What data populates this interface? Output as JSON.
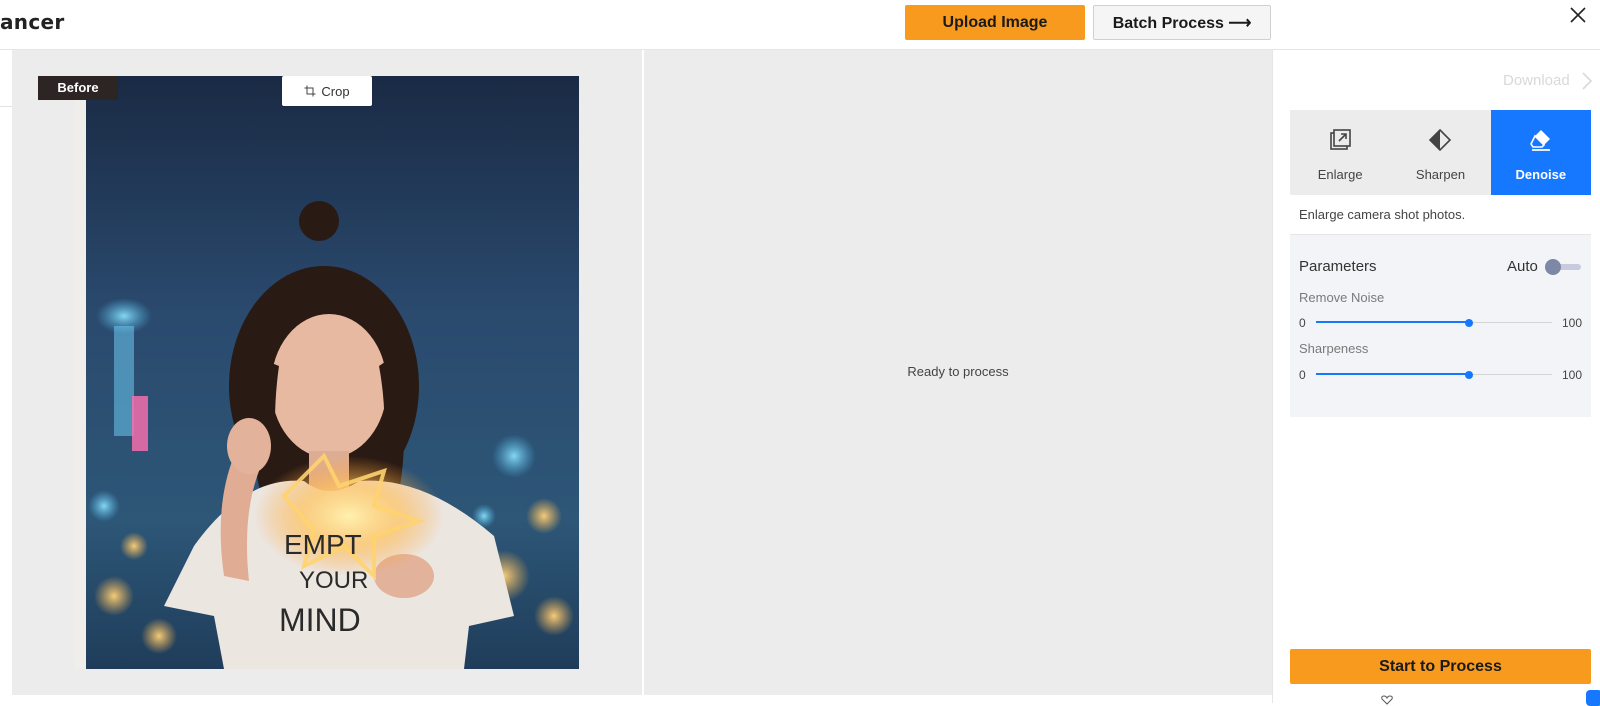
{
  "header": {
    "brand": "ancer",
    "upload_label": "Upload Image",
    "batch_label": "Batch Process",
    "batch_arrow": "⟶"
  },
  "editor": {
    "before_label": "Before",
    "crop_label": "Crop",
    "photo_shirt_text": [
      "EMPT",
      "YOUR",
      "MIND"
    ],
    "ready_text": "Ready to process"
  },
  "sidebar": {
    "download_label": "Download",
    "tabs": [
      {
        "label": "Enlarge",
        "icon": "enlarge-icon",
        "active": false
      },
      {
        "label": "Sharpen",
        "icon": "sharpen-icon",
        "active": false
      },
      {
        "label": "Denoise",
        "icon": "eraser-icon",
        "active": true
      }
    ],
    "description": "Enlarge camera shot photos.",
    "parameters": {
      "title": "Parameters",
      "auto_label": "Auto",
      "auto_enabled": false,
      "sliders": [
        {
          "label": "Remove Noise",
          "min": "0",
          "max": "100",
          "value": 65
        },
        {
          "label": "Sharpeness",
          "min": "0",
          "max": "100",
          "value": 65
        }
      ]
    },
    "start_label": "Start to Process"
  },
  "colors": {
    "accent_orange": "#f79a1e",
    "accent_blue": "#1677ff",
    "workspace_bg": "#ececec",
    "before_tag_bg": "#2c2523"
  }
}
